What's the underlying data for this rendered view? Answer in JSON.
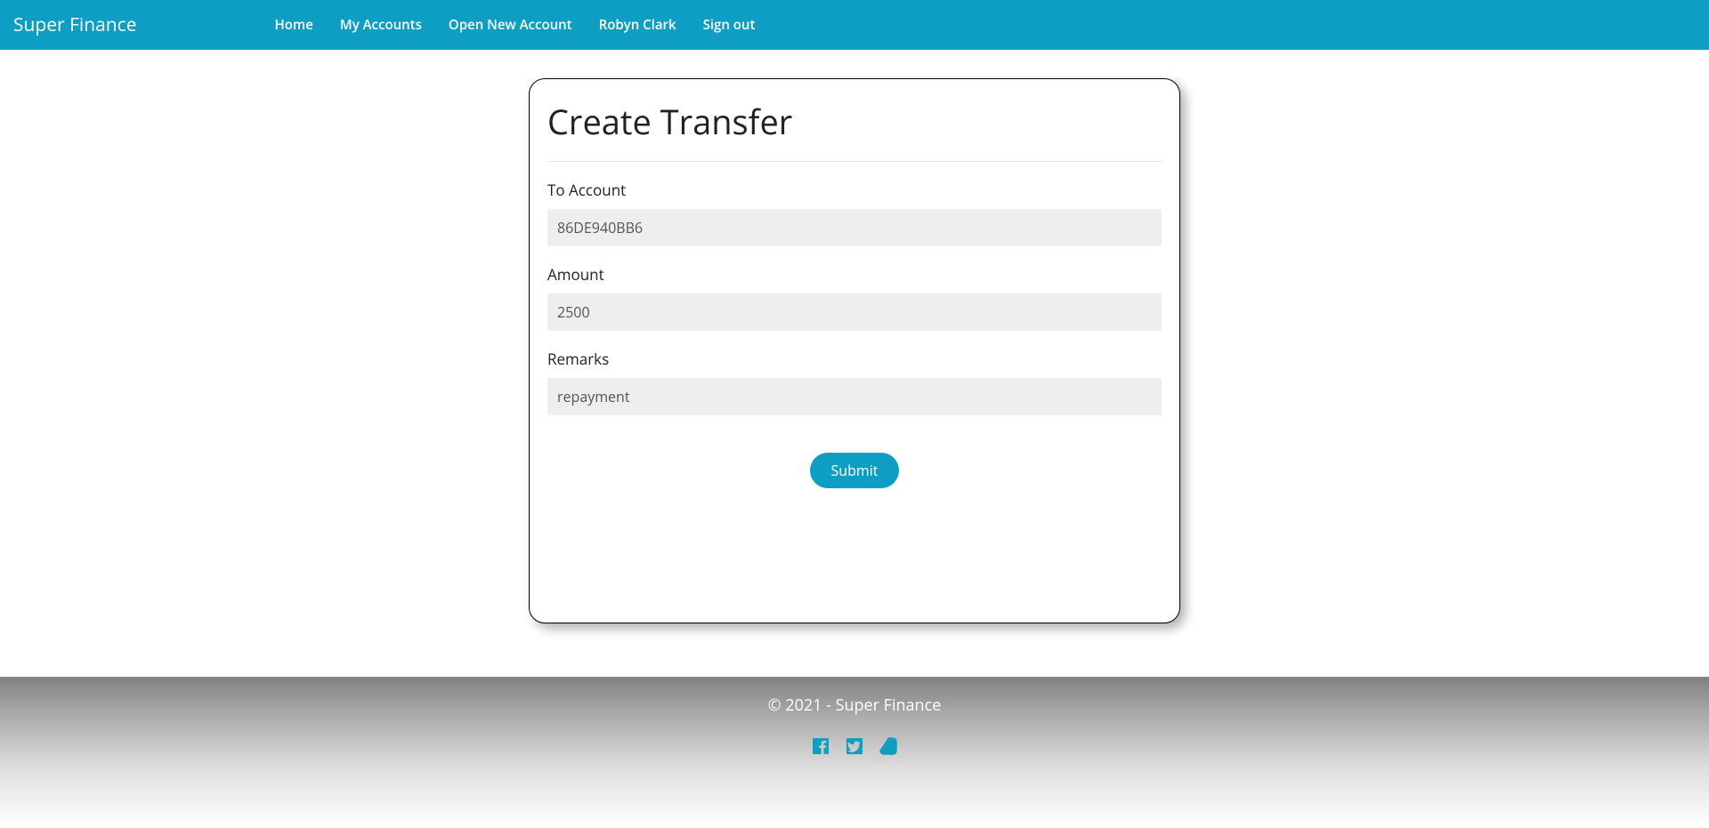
{
  "brand": "Super Finance",
  "nav": {
    "home": "Home",
    "accounts": "My Accounts",
    "open": "Open New Account",
    "user": "Robyn Clark",
    "signout": "Sign out"
  },
  "form": {
    "title": "Create Transfer",
    "toAccountLabel": "To Account",
    "toAccountValue": "86DE940BB6",
    "amountLabel": "Amount",
    "amountValue": "2500",
    "remarksLabel": "Remarks",
    "remarksValue": "repayment",
    "submitLabel": "Submit"
  },
  "footer": {
    "copyright": "© 2021 - Super Finance"
  }
}
